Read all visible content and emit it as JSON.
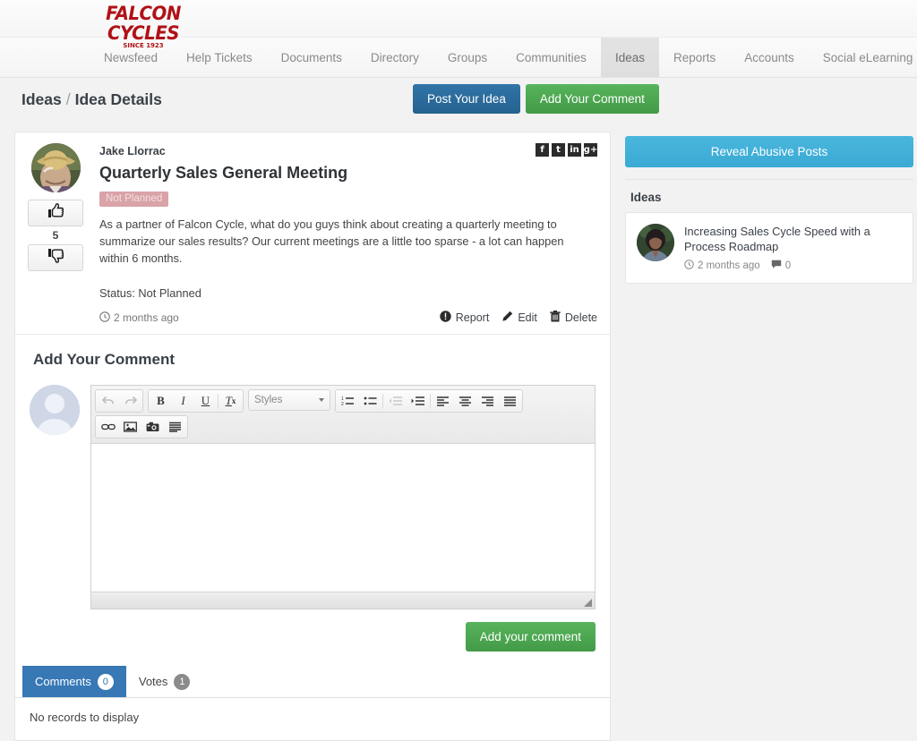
{
  "brand": {
    "name": "FALCON CYCLES",
    "tagline": "SINCE 1923",
    "color": "#b01116"
  },
  "nav": {
    "items": [
      {
        "label": "Newsfeed",
        "active": false
      },
      {
        "label": "Help Tickets",
        "active": false
      },
      {
        "label": "Documents",
        "active": false
      },
      {
        "label": "Directory",
        "active": false
      },
      {
        "label": "Groups",
        "active": false
      },
      {
        "label": "Communities",
        "active": false
      },
      {
        "label": "Ideas",
        "active": true
      },
      {
        "label": "Reports",
        "active": false
      },
      {
        "label": "Accounts",
        "active": false
      },
      {
        "label": "Social eLearning",
        "active": false
      }
    ]
  },
  "breadcrumb": {
    "root": "Ideas",
    "separator": "/",
    "current": "Idea Details"
  },
  "header_actions": {
    "post_idea": "Post Your Idea",
    "add_comment": "Add Your Comment",
    "post_idea_color": "#2a6496",
    "add_comment_color": "#4caf50"
  },
  "post": {
    "author": "Jake Llorrac",
    "title": "Quarterly Sales General Meeting",
    "status_badge": "Not Planned",
    "badge_color": "#d9a3a7",
    "body": "As a partner of Falcon Cycle, what do you guys think about creating a quarterly meeting to summarize our sales results? Our current meetings are a little too sparse - a lot can happen within 6 months.",
    "status_line": "Status: Not Planned",
    "timestamp": "2 months ago",
    "vote_count": "5",
    "actions": [
      {
        "label": "Report",
        "icon": "exclamation-circle-icon"
      },
      {
        "label": "Edit",
        "icon": "pencil-icon"
      },
      {
        "label": "Delete",
        "icon": "trash-icon"
      }
    ],
    "social": [
      {
        "name": "facebook-icon",
        "glyph": "f"
      },
      {
        "name": "twitter-icon",
        "glyph": "t"
      },
      {
        "name": "linkedin-icon",
        "glyph": "in"
      },
      {
        "name": "googleplus-icon",
        "glyph": "g+"
      }
    ]
  },
  "composer": {
    "heading": "Add Your Comment",
    "styles_label": "Styles",
    "value": "",
    "submit_label": "Add your comment",
    "submit_color": "#4caf50",
    "toolbar_row1": [
      {
        "name": "undo-icon",
        "glyph": "↶",
        "disabled": true
      },
      {
        "name": "redo-icon",
        "glyph": "↷",
        "disabled": true
      },
      {
        "name": "bold-icon",
        "glyph": "B",
        "disabled": false
      },
      {
        "name": "italic-icon",
        "glyph": "I",
        "disabled": false
      },
      {
        "name": "underline-icon",
        "glyph": "U",
        "disabled": false
      },
      {
        "name": "remove-format-icon",
        "glyph": "Tx",
        "disabled": false
      },
      {
        "name": "numbered-list-icon",
        "glyph": "≡",
        "disabled": false
      },
      {
        "name": "bulleted-list-icon",
        "glyph": "≡",
        "disabled": false
      },
      {
        "name": "outdent-icon",
        "glyph": "≡",
        "disabled": true
      },
      {
        "name": "indent-icon",
        "glyph": "≡",
        "disabled": false
      },
      {
        "name": "align-left-icon",
        "glyph": "≡",
        "disabled": false
      },
      {
        "name": "align-center-icon",
        "glyph": "≡",
        "disabled": false
      },
      {
        "name": "align-right-icon",
        "glyph": "≡",
        "disabled": false
      },
      {
        "name": "justify-icon",
        "glyph": "≡",
        "disabled": false
      }
    ],
    "toolbar_row2": [
      {
        "name": "link-icon",
        "glyph": "⚭",
        "disabled": false
      },
      {
        "name": "image-icon",
        "glyph": "Ὓc",
        "disabled": false
      },
      {
        "name": "camera-icon",
        "glyph": "◉",
        "disabled": false
      },
      {
        "name": "paragraph-icon",
        "glyph": "≡",
        "disabled": false
      }
    ]
  },
  "tabs": {
    "items": [
      {
        "label": "Comments",
        "count": "0",
        "active": true
      },
      {
        "label": "Votes",
        "count": "1",
        "active": false
      }
    ],
    "empty_text": "No records to display",
    "active_color": "#3778b5"
  },
  "sidebar": {
    "reveal_button": "Reveal Abusive Posts",
    "reveal_color": "#3aaad4",
    "section_title": "Ideas",
    "cards": [
      {
        "title": "Increasing Sales Cycle Speed with a Process Roadmap",
        "timestamp": "2 months ago",
        "comments": "0"
      }
    ]
  }
}
